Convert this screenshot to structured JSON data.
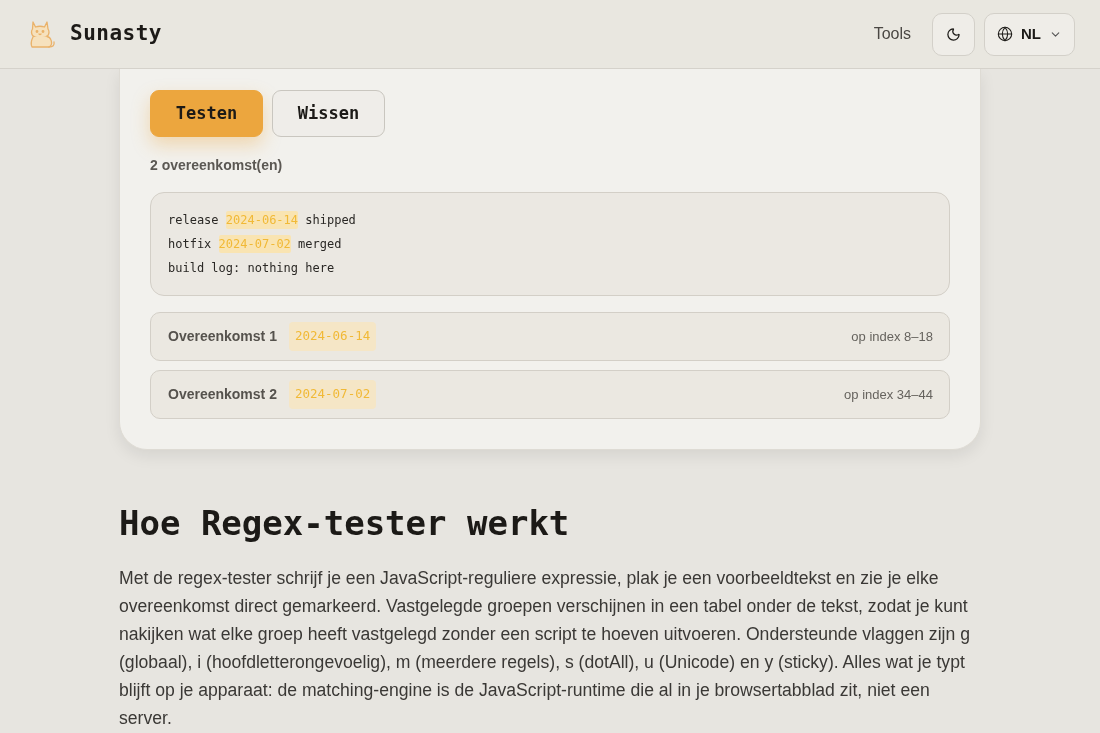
{
  "header": {
    "brand": "Sunasty",
    "nav": [
      {
        "label": "Tools"
      }
    ],
    "language": "NL"
  },
  "tester": {
    "buttons": [
      {
        "label": "Testen",
        "kind": "primary"
      },
      {
        "label": "Wissen",
        "kind": "secondary"
      }
    ],
    "match_count": "2 overeenkomst(en)",
    "test_text": [
      {
        "segments": [
          {
            "text": "release ",
            "match": false
          },
          {
            "text": "2024-06-14",
            "match": true
          },
          {
            "text": " shipped",
            "match": false
          }
        ]
      },
      {
        "segments": [
          {
            "text": "hotfix ",
            "match": false
          },
          {
            "text": "2024-07-02",
            "match": true
          },
          {
            "text": " merged",
            "match": false
          }
        ]
      },
      {
        "segments": [
          {
            "text": "build log: nothing here",
            "match": false
          }
        ]
      }
    ],
    "matches": [
      {
        "label": "Overeenkomst 1",
        "value": "2024-06-14",
        "position": "op index 8–18"
      },
      {
        "label": "Overeenkomst 2",
        "value": "2024-07-02",
        "position": "op index 34–44"
      }
    ]
  },
  "article": {
    "heading": "Hoe Regex-tester werkt",
    "paragraph": "Met de regex-tester schrijf je een JavaScript-reguliere expressie, plak je een voorbeeldtekst en zie je elke overeenkomst direct gemarkeerd. Vastgelegde groepen verschijnen in een tabel onder de tekst, zodat je kunt nakijken wat elke groep heeft vastgelegd zonder een script te hoeven uitvoeren. Ondersteunde vlaggen zijn g (globaal), i (hoofdletterongevoelig), m (meerdere regels), s (dotAll), u (Unicode) en y (sticky). Alles wat je typt blijft op je apparaat: de matching-engine is de JavaScript-runtime die al in je browsertabblad zit, niet een server."
  }
}
